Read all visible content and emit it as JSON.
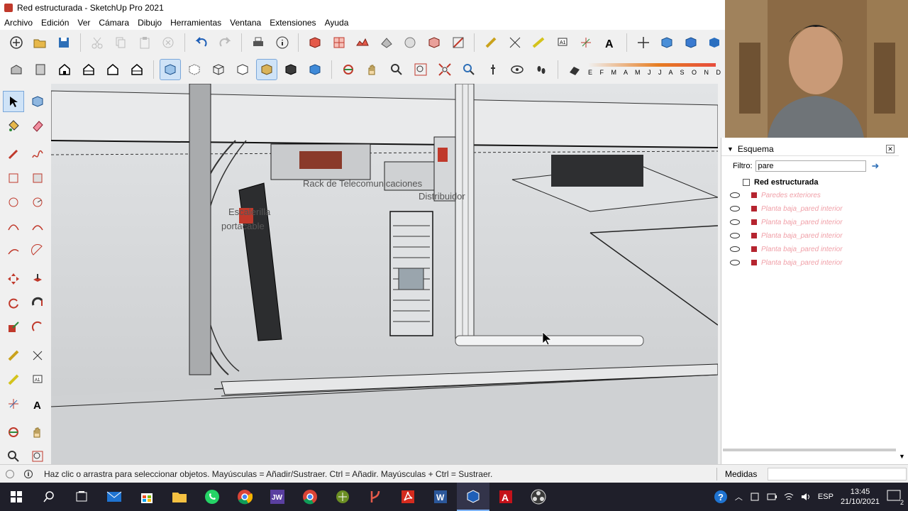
{
  "window": {
    "title": "Red estructurada - SketchUp Pro 2021"
  },
  "menu": [
    "Archivo",
    "Edición",
    "Ver",
    "Cámara",
    "Dibujo",
    "Herramientas",
    "Ventana",
    "Extensiones",
    "Ayuda"
  ],
  "toolbar2_letters": "E F M A M J J A S O N D",
  "viewport": {
    "labels": {
      "rack": "Rack de Telecomunicaciones",
      "distribuidor": "Distribuidor",
      "escalerilla_1": "Escalerilla",
      "escalerilla_2": "portacable"
    }
  },
  "panel": {
    "section_title": "Esquema",
    "filter_label": "Filtro:",
    "filter_value": "pare",
    "root": "Red estructurada",
    "items": [
      "Paredes exteriores",
      "Planta baja_pared interior",
      "Planta baja_pared interior",
      "Planta baja_pared interior",
      "Planta baja_pared interior",
      "Planta baja_pared interior"
    ]
  },
  "status": {
    "hint": "Haz clic o arrastra para seleccionar objetos. Mayúsculas = Añadir/Sustraer. Ctrl = Añadir. Mayúsculas + Ctrl = Sustraer.",
    "measures_label": "Medidas"
  },
  "taskbar": {
    "language": "ESP",
    "time": "13:45",
    "date": "21/10/2021",
    "notification_count": "2"
  },
  "colors": {
    "accent": "#7aa7d9",
    "layer_color": "#b5242f",
    "taskbar": "#1f1f2a"
  }
}
